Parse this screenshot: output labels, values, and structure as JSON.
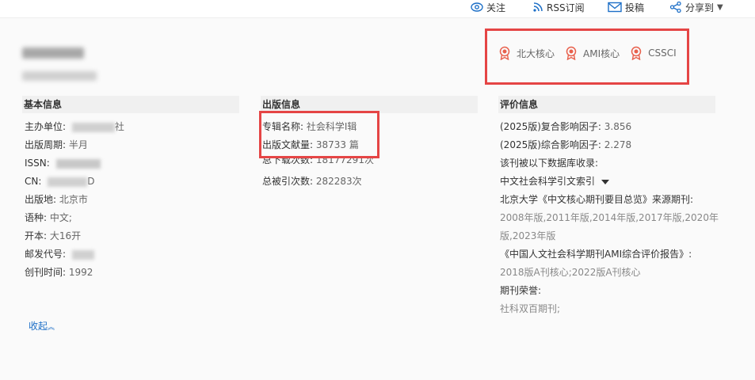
{
  "toolbar": {
    "follow": "关注",
    "rss": "RSS订阅",
    "submit": "投稿",
    "share": "分享到"
  },
  "badges": [
    "北大核心",
    "AMI核心",
    "CSSCI"
  ],
  "colors": {
    "accent": "#e54545",
    "link": "#1d6fc7",
    "badge_icon": "#e8604c"
  },
  "basic": {
    "title": "基本信息",
    "sponsor_label": "主办单位:",
    "sponsor_value_tail": "社",
    "period_label": "出版周期:",
    "period_value": "半月",
    "issn_label": "ISSN:",
    "cn_label": "CN:",
    "cn_value_tail": "D",
    "place_label": "出版地:",
    "place_value": "北京市",
    "lang_label": "语种:",
    "lang_value": "中文;",
    "format_label": "开本:",
    "format_value": "大16开",
    "postal_label": "邮发代号:",
    "founded_label": "创刊时间:",
    "founded_value": "1992"
  },
  "publish": {
    "title": "出版信息",
    "series_label": "专辑名称:",
    "series_value": "社会科学Ⅰ辑",
    "articles_label": "出版文献量:",
    "articles_value": "38733 篇",
    "downloads_label": "总下载次数:",
    "downloads_value": "18177291次",
    "citations_label": "总被引次数:",
    "citations_value": "282283次"
  },
  "eval": {
    "title": "评价信息",
    "if_comp_label": "(2025版)复合影响因子:",
    "if_comp_value": "3.856",
    "if_total_label": "(2025版)综合影响因子:",
    "if_total_value": "2.278",
    "indexed_by": "该刊被以下数据库收录:",
    "cssci_dropdown": "中文社会科学引文索引",
    "pku_label": "北京大学《中文核心期刊要目总览》来源期刊:",
    "pku_years_line1": "2008年版,2011年版,2014年版,2017年版,2020年",
    "pku_years_line2": "版,2023年版",
    "ami_label": "《中国人文社会科学期刊AMI综合评价报告》:",
    "ami_years": "2018版A刊核心;2022版A刊核心",
    "honors_label": "期刊荣誉:",
    "honors_value": "社科双百期刊;"
  },
  "collapse": "收起"
}
